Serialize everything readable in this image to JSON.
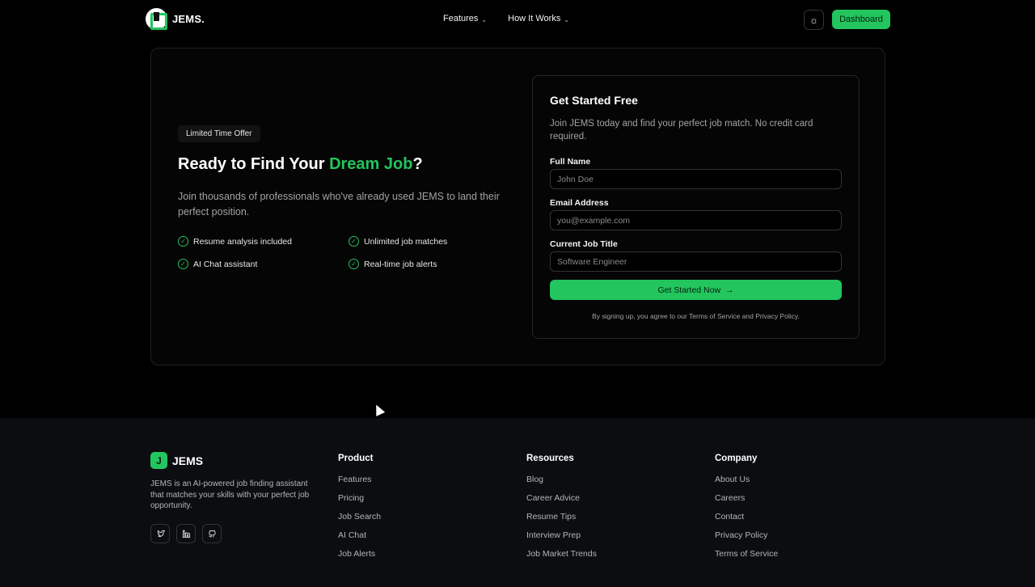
{
  "nav": {
    "logo_text": "JEMS.",
    "menu": [
      {
        "label": "Features"
      },
      {
        "label": "How It Works"
      }
    ],
    "dashboard_label": "Dashboard"
  },
  "hero": {
    "badge": "Limited Time Offer",
    "title_pre": "Ready to Find Your ",
    "title_accent": "Dream Job",
    "title_post": "?",
    "subtitle": "Join thousands of professionals who've already used JEMS to land their perfect position.",
    "features": [
      "Resume analysis included",
      "Unlimited job matches",
      "AI Chat assistant",
      "Real-time job alerts"
    ]
  },
  "form": {
    "title": "Get Started Free",
    "description": "Join JEMS today and find your perfect job match. No credit card required.",
    "fields": [
      {
        "label": "Full Name",
        "placeholder": "John Doe"
      },
      {
        "label": "Email Address",
        "placeholder": "you@example.com"
      },
      {
        "label": "Current Job Title",
        "placeholder": "Software Engineer"
      }
    ],
    "submit_label": "Get Started Now",
    "terms": "By signing up, you agree to our Terms of Service and Privacy Policy."
  },
  "footer": {
    "brand_mark": "J",
    "brand": "JEMS",
    "description": "JEMS is an AI-powered job finding assistant that matches your skills with your perfect job opportunity.",
    "columns": [
      {
        "title": "Product",
        "links": [
          "Features",
          "Pricing",
          "Job Search",
          "AI Chat",
          "Job Alerts"
        ]
      },
      {
        "title": "Resources",
        "links": [
          "Blog",
          "Career Advice",
          "Resume Tips",
          "Interview Prep",
          "Job Market Trends"
        ]
      },
      {
        "title": "Company",
        "links": [
          "About Us",
          "Careers",
          "Contact",
          "Privacy Policy",
          "Terms of Service"
        ]
      }
    ]
  },
  "colors": {
    "accent": "#22c55e",
    "background": "#000000",
    "footer_bg": "#0b0d10"
  },
  "icons": [
    "sun-icon",
    "chevron-down-icon",
    "check-circle-icon",
    "arrow-right-icon",
    "twitter-icon",
    "linkedin-icon",
    "github-icon"
  ]
}
